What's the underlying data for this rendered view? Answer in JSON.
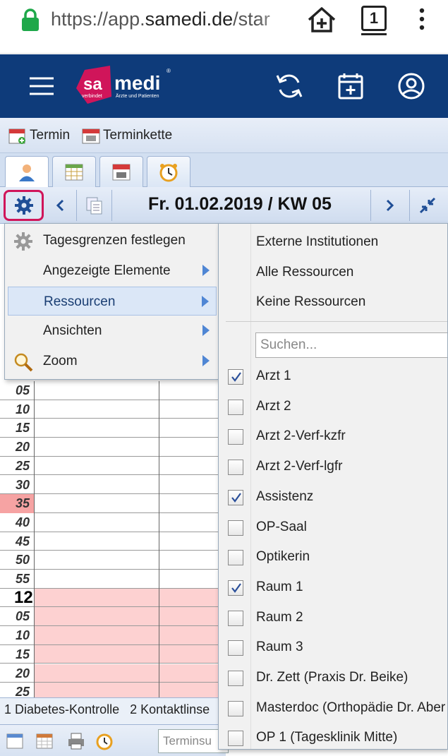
{
  "browser": {
    "url_host": "https://app.",
    "url_domain": "samedi.de",
    "url_path": "/star",
    "tab_count": "1"
  },
  "app": {
    "logo_sa": "sa",
    "logo_medi": "medi",
    "logo_tagline_left": "verbindet",
    "logo_tagline_right": "Ärzte und Patienten",
    "logo_reg": "®"
  },
  "toolbar": {
    "termin_label": "Termin",
    "terminkette_label": "Terminkette"
  },
  "datenav": {
    "date_label": "Fr. 01.02.2019 / KW 05"
  },
  "menu": {
    "items": [
      {
        "label": "Tagesgrenzen festlegen",
        "has_submenu": false,
        "icon": "gear-icon"
      },
      {
        "label": "Angezeigte Elemente",
        "has_submenu": true,
        "icon": ""
      },
      {
        "label": "Ressourcen",
        "has_submenu": true,
        "icon": "",
        "highlighted": true
      },
      {
        "label": "Ansichten",
        "has_submenu": true,
        "icon": ""
      },
      {
        "label": "Zoom",
        "has_submenu": true,
        "icon": "magnifier-icon"
      }
    ]
  },
  "submenu": {
    "top_items": [
      "Externe Institutionen",
      "Alle Ressourcen",
      "Keine Ressourcen"
    ],
    "search_placeholder": "Suchen...",
    "resources": [
      {
        "label": "Arzt 1",
        "checked": true
      },
      {
        "label": "Arzt 2",
        "checked": false
      },
      {
        "label": "Arzt 2-Verf-kzfr",
        "checked": false
      },
      {
        "label": "Arzt 2-Verf-lgfr",
        "checked": false
      },
      {
        "label": "Assistenz",
        "checked": true
      },
      {
        "label": "OP-Saal",
        "checked": false
      },
      {
        "label": "Optikerin",
        "checked": false
      },
      {
        "label": "Raum 1",
        "checked": true
      },
      {
        "label": "Raum 2",
        "checked": false
      },
      {
        "label": "Raum 3",
        "checked": false
      },
      {
        "label": "Dr. Zett (Praxis Dr. Beike)",
        "checked": false
      },
      {
        "label": "Masterdoc (Orthopädie Dr. Aber",
        "checked": false
      },
      {
        "label": "OP 1 (Tagesklinik Mitte)",
        "checked": false
      }
    ]
  },
  "grid": {
    "times": [
      {
        "label": "05",
        "hour": false,
        "highlight": false,
        "pink": false
      },
      {
        "label": "10",
        "hour": false,
        "highlight": false,
        "pink": false
      },
      {
        "label": "15",
        "hour": false,
        "highlight": false,
        "pink": false
      },
      {
        "label": "20",
        "hour": false,
        "highlight": false,
        "pink": false
      },
      {
        "label": "25",
        "hour": false,
        "highlight": false,
        "pink": false
      },
      {
        "label": "30",
        "hour": false,
        "highlight": false,
        "pink": false
      },
      {
        "label": "35",
        "hour": false,
        "highlight": true,
        "pink": false
      },
      {
        "label": "40",
        "hour": false,
        "highlight": false,
        "pink": false
      },
      {
        "label": "45",
        "hour": false,
        "highlight": false,
        "pink": false
      },
      {
        "label": "50",
        "hour": false,
        "highlight": false,
        "pink": false
      },
      {
        "label": "55",
        "hour": false,
        "highlight": false,
        "pink": false
      },
      {
        "label": "12",
        "hour": true,
        "highlight": false,
        "pink": true
      },
      {
        "label": "05",
        "hour": false,
        "highlight": false,
        "pink": true
      },
      {
        "label": "10",
        "hour": false,
        "highlight": false,
        "pink": true
      },
      {
        "label": "15",
        "hour": false,
        "highlight": false,
        "pink": true
      },
      {
        "label": "20",
        "hour": false,
        "highlight": false,
        "pink": true
      },
      {
        "label": "25",
        "hour": false,
        "highlight": false,
        "pink": true
      }
    ]
  },
  "bottom": {
    "legend": [
      "1 Diabetes-Kontrolle",
      "2 Kontaktlinse"
    ],
    "search_placeholder": "Terminsu"
  },
  "colors": {
    "header_bg": "#0e3b7a",
    "brand_pink": "#d0155a",
    "highlight_time": "#f6a3a3",
    "pink_cell": "#fdd1d1"
  }
}
